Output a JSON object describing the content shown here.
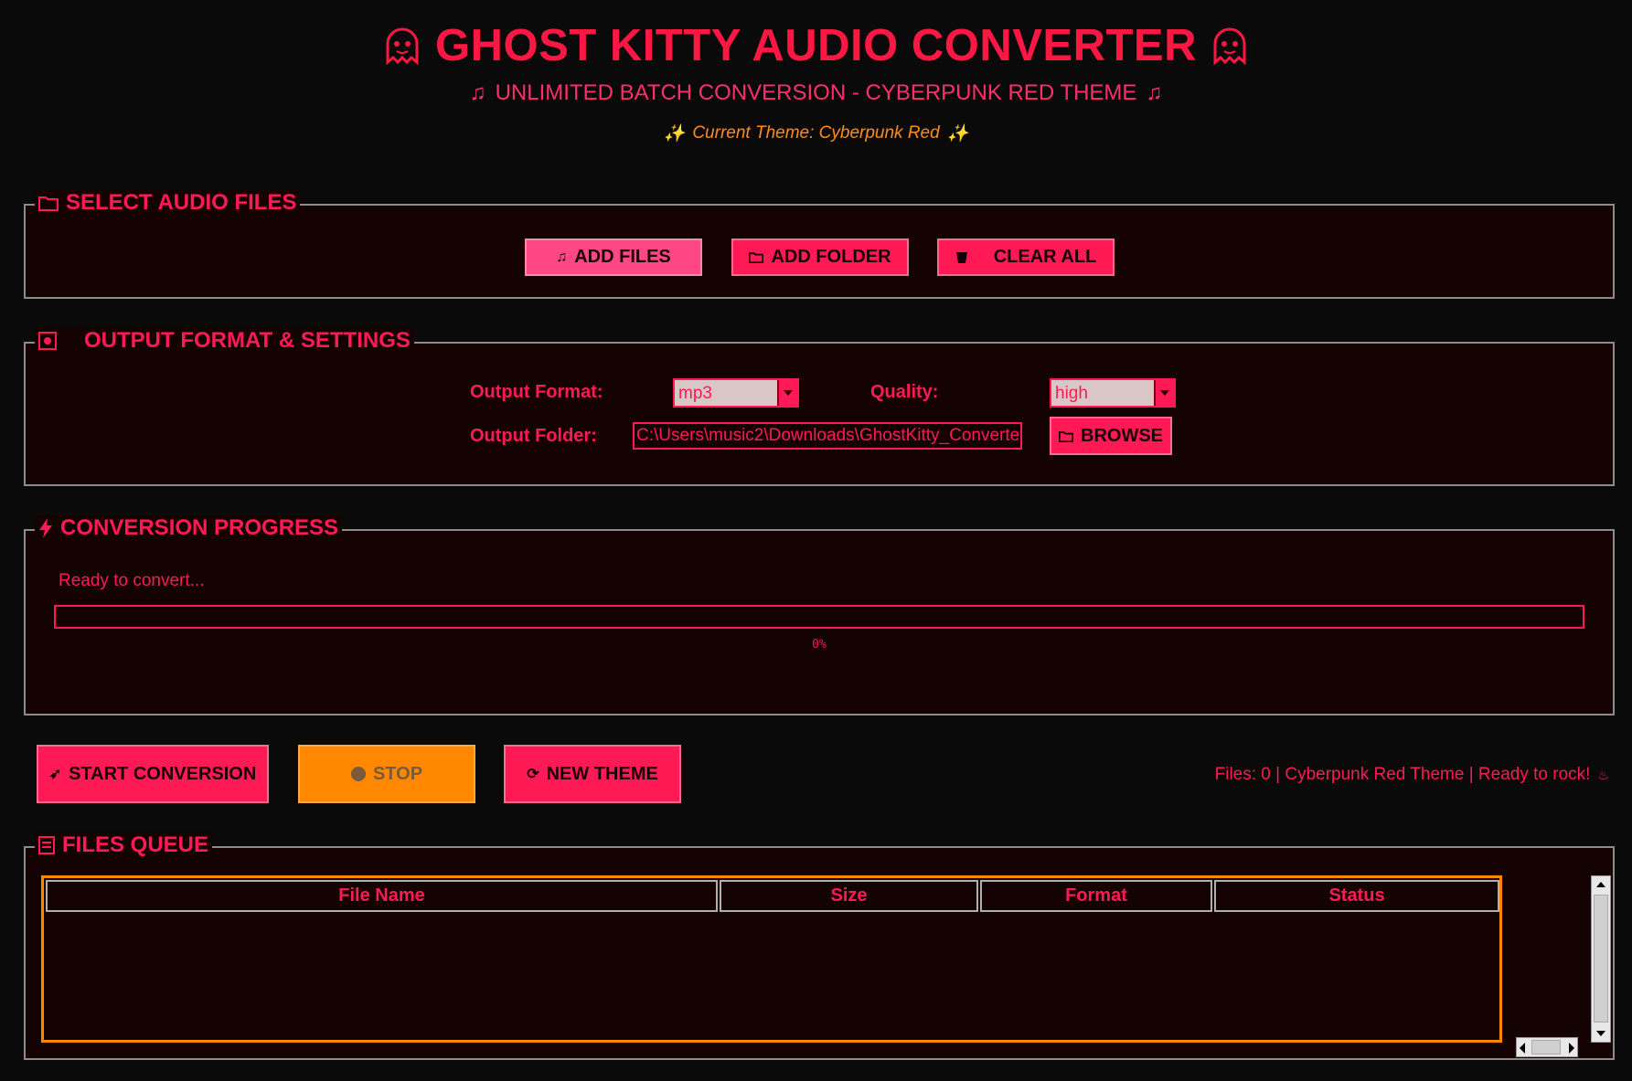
{
  "header": {
    "title": "GHOST KITTY AUDIO CONVERTER",
    "subtitle": "UNLIMITED BATCH CONVERSION - CYBERPUNK RED THEME",
    "theme_line": "Current Theme: Cyberpunk Red"
  },
  "select_files": {
    "title": "SELECT AUDIO FILES",
    "add_files_label": "ADD FILES",
    "add_folder_label": "ADD FOLDER",
    "clear_all_label": "CLEAR ALL"
  },
  "output_settings": {
    "title": "OUTPUT FORMAT & SETTINGS",
    "format_label": "Output Format:",
    "format_value": "mp3",
    "quality_label": "Quality:",
    "quality_value": "high",
    "folder_label": "Output Folder:",
    "folder_value": "C:\\Users\\music2\\Downloads\\GhostKitty_Converte",
    "browse_label": "BROWSE"
  },
  "progress": {
    "title": "CONVERSION PROGRESS",
    "status_text": "Ready to convert...",
    "percent_text": "0%",
    "fraction": 0
  },
  "actions": {
    "start_label": "START CONVERSION",
    "stop_label": "STOP",
    "new_theme_label": "NEW THEME",
    "status_bar": "Files: 0 | Cyberpunk Red Theme | Ready to rock!"
  },
  "queue": {
    "title": "FILES QUEUE",
    "columns": [
      "File Name",
      "Size",
      "Format",
      "Status"
    ],
    "rows": []
  },
  "colors": {
    "accent": "#ff1a55",
    "secondary": "#ff8800",
    "background": "#0a0a0a",
    "panel": "#150203"
  }
}
